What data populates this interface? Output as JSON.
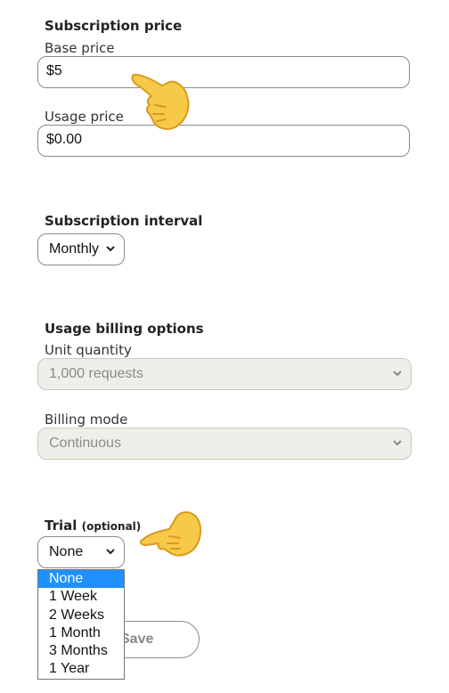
{
  "subscription_price": {
    "heading": "Subscription price",
    "base_label": "Base price",
    "base_value": "$5",
    "usage_label": "Usage price",
    "usage_value": "$0.00"
  },
  "interval": {
    "heading": "Subscription interval",
    "selected": "Monthly"
  },
  "usage_billing": {
    "heading": "Usage billing options",
    "unit_label": "Unit quantity",
    "unit_value": "1,000 requests",
    "mode_label": "Billing mode",
    "mode_value": "Continuous"
  },
  "trial": {
    "heading": "Trial",
    "optional": "(optional)",
    "selected": "None",
    "options": [
      "None",
      "1 Week",
      "2 Weeks",
      "1 Month",
      "3 Months",
      "1 Year"
    ]
  },
  "save_button": {
    "label": "Save"
  },
  "icons": {
    "pointer": "pointing-hand-icon",
    "chevron": "chevron-down-icon"
  },
  "colors": {
    "highlight": "#1e90ff",
    "disabled_bg": "#efefea",
    "hand": "#f7c948"
  }
}
